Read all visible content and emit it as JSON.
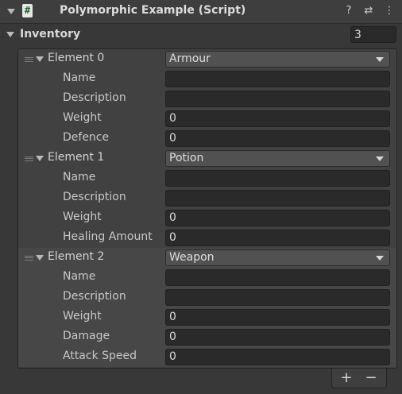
{
  "header": {
    "title": "Polymorphic Example (Script)",
    "icons": [
      "script-icon",
      "help-icon",
      "settings-sliders-icon",
      "more-vertical-icon"
    ],
    "help_glyph": "?",
    "preset_glyph": "⇄",
    "more_glyph": "⋮"
  },
  "inventory": {
    "label": "Inventory",
    "count": "3"
  },
  "elements": [
    {
      "label": "Element 0",
      "type": "Armour",
      "fields": [
        {
          "name": "Name",
          "value": ""
        },
        {
          "name": "Description",
          "value": ""
        },
        {
          "name": "Weight",
          "value": "0"
        },
        {
          "name": "Defence",
          "value": "0"
        }
      ]
    },
    {
      "label": "Element 1",
      "type": "Potion",
      "fields": [
        {
          "name": "Name",
          "value": ""
        },
        {
          "name": "Description",
          "value": ""
        },
        {
          "name": "Weight",
          "value": "0"
        },
        {
          "name": "Healing Amount",
          "value": "0"
        }
      ]
    },
    {
      "label": "Element 2",
      "type": "Weapon",
      "fields": [
        {
          "name": "Name",
          "value": ""
        },
        {
          "name": "Description",
          "value": ""
        },
        {
          "name": "Weight",
          "value": "0"
        },
        {
          "name": "Damage",
          "value": "0"
        },
        {
          "name": "Attack Speed",
          "value": "0"
        }
      ]
    }
  ],
  "footer": {
    "add_label": "+",
    "remove_label": "−"
  }
}
